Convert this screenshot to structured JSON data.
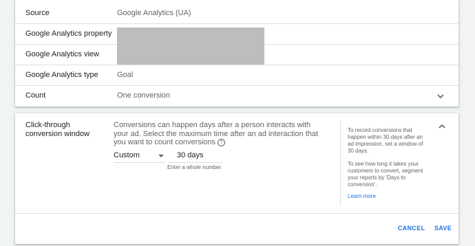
{
  "settings": {
    "rows": [
      {
        "label": "Source",
        "value": "Google Analytics (UA)"
      },
      {
        "label": "Google Analytics property",
        "value": ""
      },
      {
        "label": "Google Analytics view",
        "value": ""
      },
      {
        "label": "Google Analytics type",
        "value": "Goal"
      },
      {
        "label": "Count",
        "value": "One conversion"
      }
    ]
  },
  "click_through": {
    "label": "Click-through conversion window",
    "description": "Conversions can happen days after a person interacts with your ad. Select the maximum time after an ad interaction that you want to count conversions",
    "help_icon_glyph": "?",
    "select_value": "Custom",
    "days_value": "30 days",
    "hint": "Enter a whole number",
    "side_text_1": "To record conversions that happen within 30 days after an ad impression, set a window of 30 days.",
    "side_text_2": "To see how long it takes your customers to convert, segment your reports by 'Days to conversion'.",
    "learn_more": "Learn more"
  },
  "actions": {
    "cancel": "CANCEL",
    "save": "SAVE"
  },
  "colors": {
    "accent": "#1a73e8",
    "redaction": "#bdbdbd",
    "background": "#f1f3f4"
  },
  "icons": {
    "count_expand": "chevron-down-icon",
    "section_collapse": "chevron-up-icon",
    "help": "help-icon",
    "select_caret": "caret-down-icon"
  }
}
